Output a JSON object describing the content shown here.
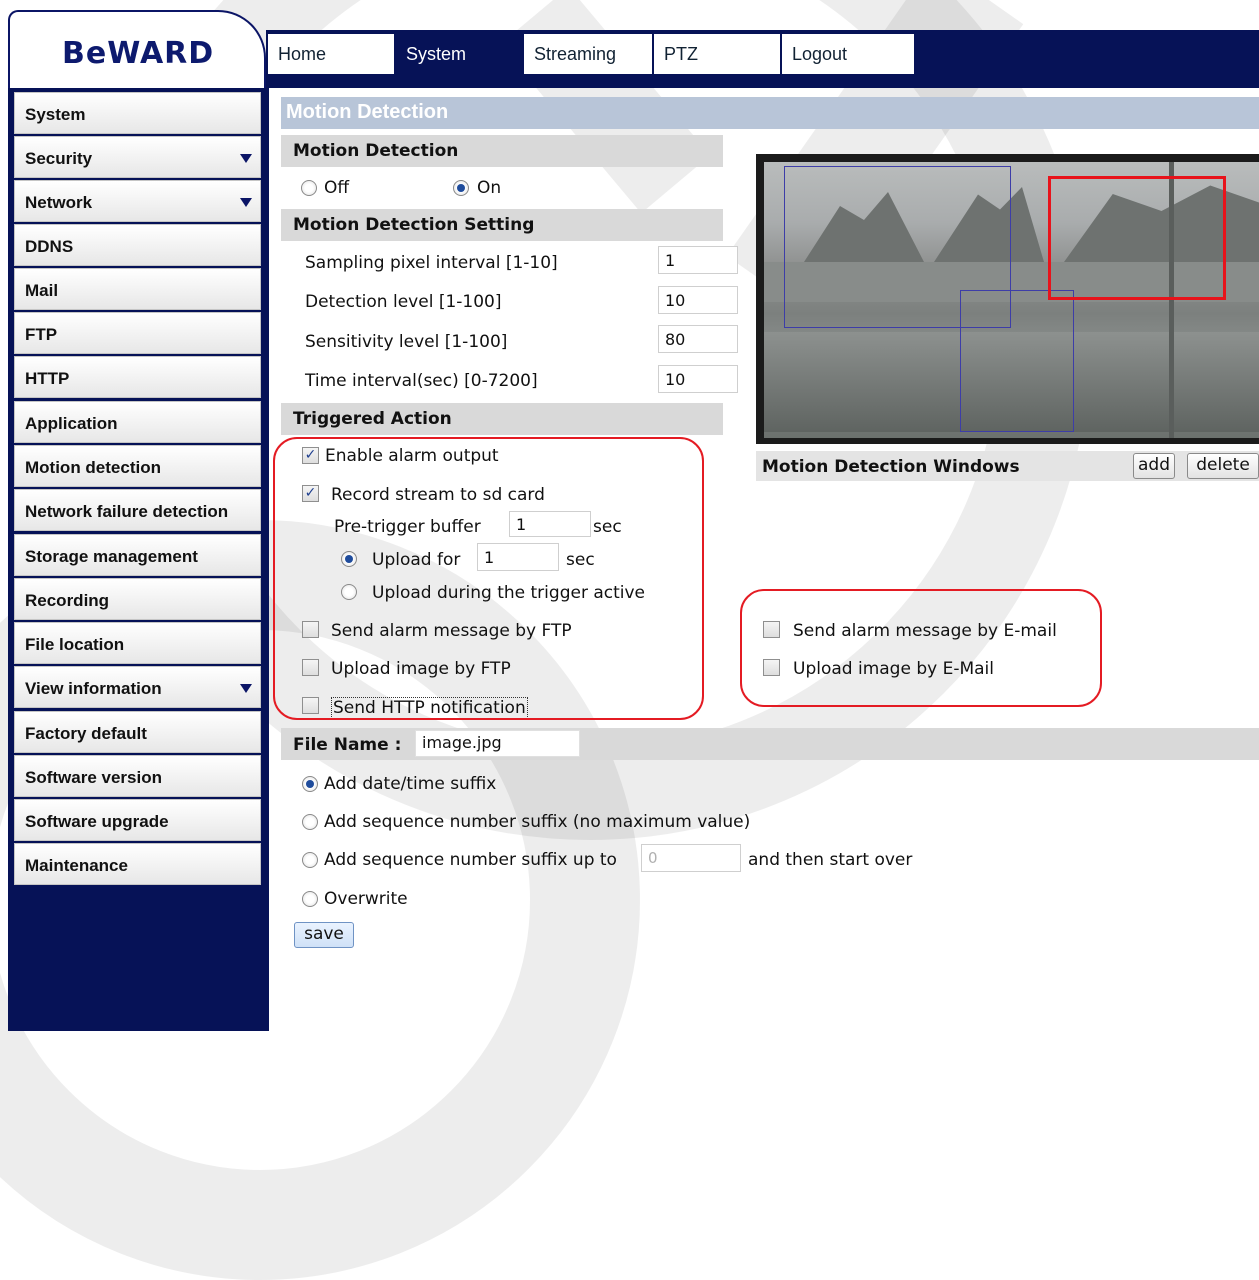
{
  "brand": {
    "logo_text": "BeWARD"
  },
  "nav": {
    "tabs": [
      {
        "label": "Home",
        "active": false
      },
      {
        "label": "System",
        "active": true
      },
      {
        "label": "Streaming",
        "active": false
      },
      {
        "label": "PTZ",
        "active": false
      },
      {
        "label": "Logout",
        "active": false
      }
    ]
  },
  "sidebar": {
    "items": [
      {
        "label": "System",
        "has_submenu": false
      },
      {
        "label": "Security",
        "has_submenu": true
      },
      {
        "label": "Network",
        "has_submenu": true
      },
      {
        "label": "DDNS",
        "has_submenu": false
      },
      {
        "label": "Mail",
        "has_submenu": false
      },
      {
        "label": "FTP",
        "has_submenu": false
      },
      {
        "label": "HTTP",
        "has_submenu": false
      },
      {
        "label": "Application",
        "has_submenu": false
      },
      {
        "label": "Motion detection",
        "has_submenu": false
      },
      {
        "label": "Network failure detection",
        "has_submenu": false
      },
      {
        "label": "Storage management",
        "has_submenu": false
      },
      {
        "label": "Recording",
        "has_submenu": false
      },
      {
        "label": "File location",
        "has_submenu": false
      },
      {
        "label": "View information",
        "has_submenu": true
      },
      {
        "label": "Factory default",
        "has_submenu": false
      },
      {
        "label": "Software version",
        "has_submenu": false
      },
      {
        "label": "Software upgrade",
        "has_submenu": false
      },
      {
        "label": "Maintenance",
        "has_submenu": false
      }
    ]
  },
  "page": {
    "title": "Motion Detection"
  },
  "motion": {
    "heading": "Motion Detection",
    "off_label": "Off",
    "on_label": "On",
    "selected": "On"
  },
  "settings": {
    "heading": "Motion Detection Setting",
    "fields": [
      {
        "label": "Sampling pixel interval [1-10]",
        "value": "1"
      },
      {
        "label": "Detection level [1-100]",
        "value": "10"
      },
      {
        "label": "Sensitivity level [1-100]",
        "value": "80"
      },
      {
        "label": "Time interval(sec) [0-7200]",
        "value": "10"
      }
    ]
  },
  "triggered": {
    "heading": "Triggered Action",
    "enable_alarm": {
      "label": "Enable alarm output",
      "checked": true
    },
    "record_sd": {
      "label": "Record stream to sd card",
      "checked": true
    },
    "pretrigger": {
      "label": "Pre-trigger buffer",
      "value": "1",
      "unit": "sec"
    },
    "upload_for": {
      "label": "Upload for",
      "value": "1",
      "unit": "sec",
      "selected": true
    },
    "upload_during": {
      "label": "Upload during the trigger active",
      "selected": false
    },
    "ftp_alarm": {
      "label": "Send alarm message by FTP",
      "checked": false
    },
    "ftp_image": {
      "label": "Upload image by FTP",
      "checked": false
    },
    "http_notify": {
      "label": "Send HTTP notification",
      "checked": false
    },
    "email_alarm": {
      "label": "Send alarm message by E-mail",
      "checked": false
    },
    "email_image": {
      "label": "Upload image by E-Mail",
      "checked": false
    }
  },
  "windows_panel": {
    "label": "Motion Detection Windows",
    "add_label": "add",
    "delete_label": "delete"
  },
  "file": {
    "label": "File Name :",
    "value": "image.jpg",
    "options": [
      {
        "label": "Add date/time suffix",
        "selected": true
      },
      {
        "label": "Add sequence number suffix (no maximum value)",
        "selected": false
      },
      {
        "label": "Add sequence number suffix up to",
        "selected": false,
        "input_placeholder": "0",
        "suffix": "and then start over"
      },
      {
        "label": "Overwrite",
        "selected": false
      }
    ],
    "save_label": "save"
  },
  "colors": {
    "nav_bg": "#061257",
    "highlight": "#e41b23",
    "title_bar": "#b8c5d8",
    "section_bg": "#d9d9d9"
  }
}
